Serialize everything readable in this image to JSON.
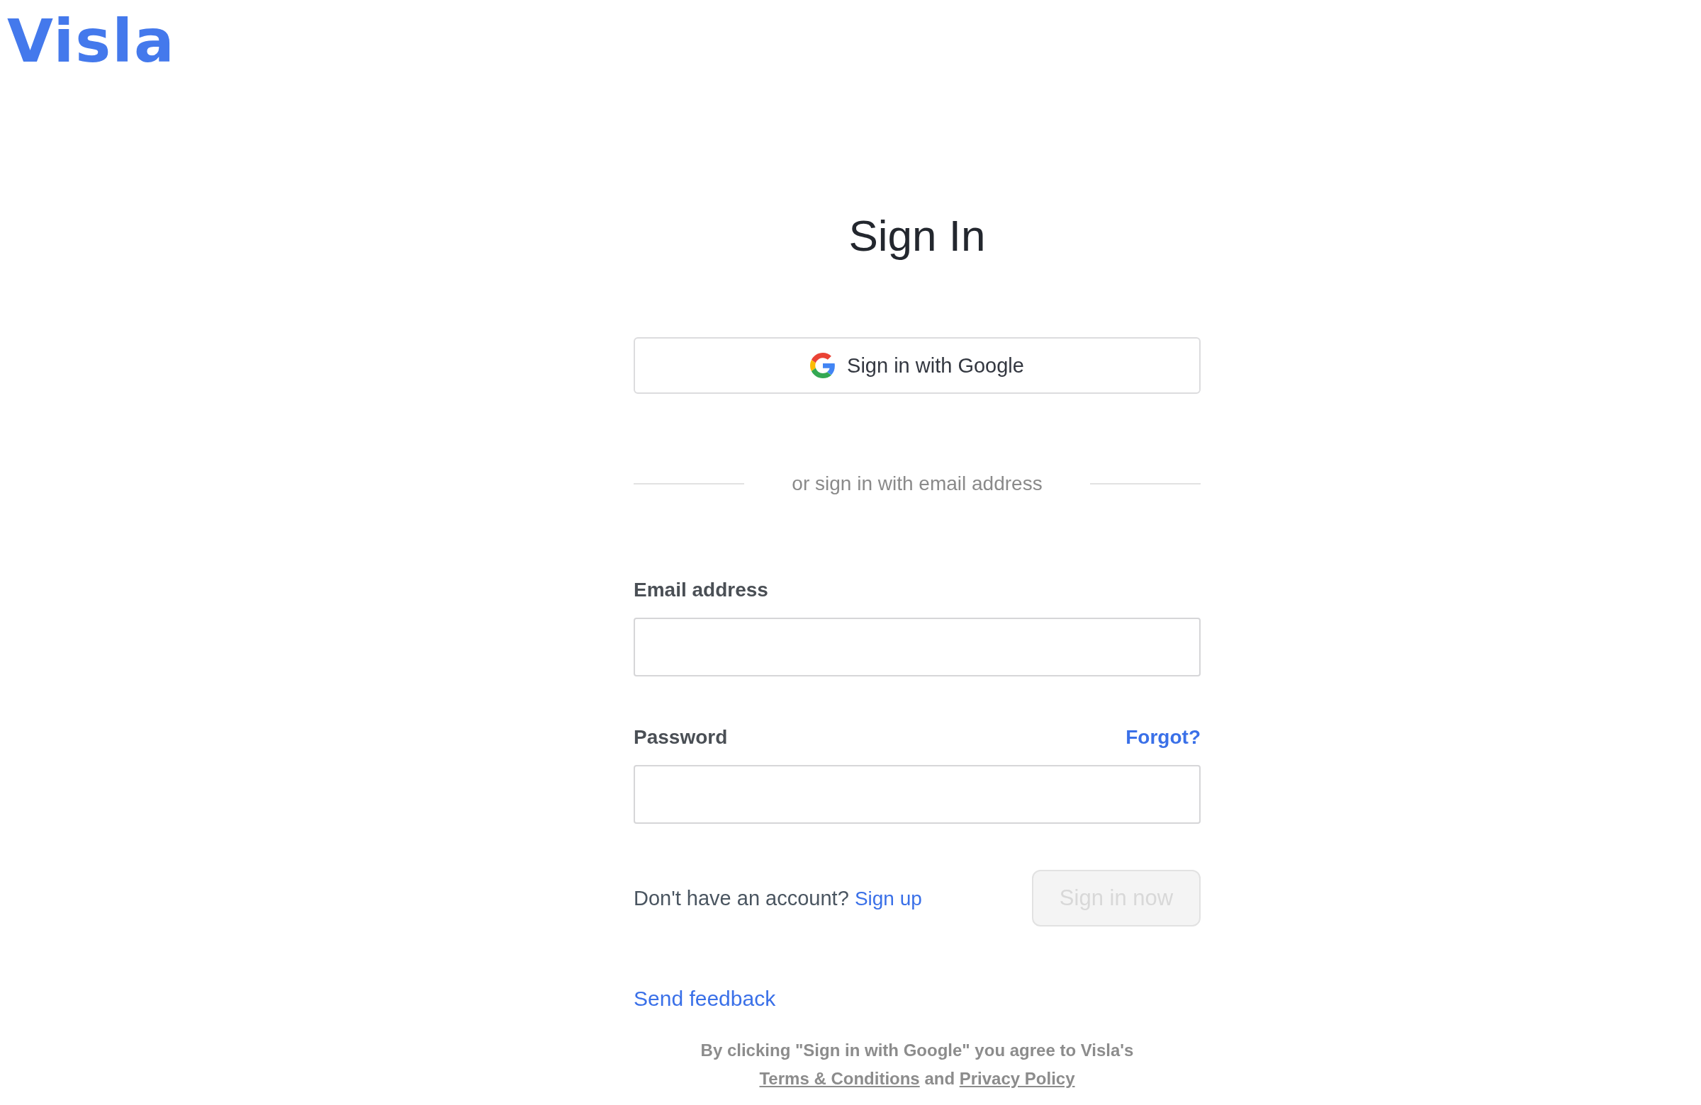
{
  "header": {
    "logo": "Visla"
  },
  "title": "Sign In",
  "google_button": {
    "label": "Sign in with Google"
  },
  "divider_text": "or sign in with email address",
  "fields": [
    {
      "label": "Email address"
    },
    {
      "label": "Password",
      "link": "Forgot?"
    }
  ],
  "signup": {
    "text": "Don't have an account?",
    "link": "Sign up"
  },
  "submit_button": {
    "label": "Sign in now",
    "disabled": true
  },
  "feedback_link": "Send feedback",
  "legal": {
    "text": "By clicking \"Sign in with Google\" you agree to Visla's",
    "links": [
      "Terms & Conditions",
      "Privacy Policy"
    ],
    "joiner": "and"
  }
}
